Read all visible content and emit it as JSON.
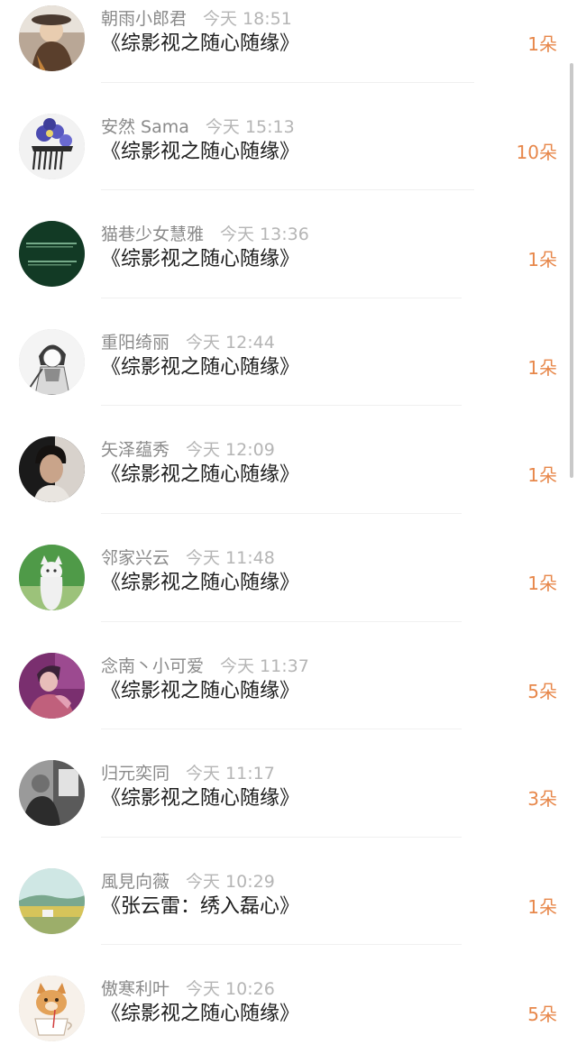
{
  "list": {
    "items": [
      {
        "name": "朝雨小郎君",
        "time": "今天 18:51",
        "title": "《综影视之随心随缘》",
        "count": "1朵",
        "avatar": "girl-with-hat-avatar"
      },
      {
        "name": "安然 Sama",
        "time": "今天 15:13",
        "title": "《综影视之随心随缘》",
        "count": "10朵",
        "avatar": "purple-flower-hairpin-avatar"
      },
      {
        "name": "猫巷少女慧雅",
        "time": "今天 13:36",
        "title": "《综影视之随心随缘》",
        "count": "1朵",
        "avatar": "green-text-avatar"
      },
      {
        "name": "重阳绮丽",
        "time": "今天 12:44",
        "title": "《综影视之随心随缘》",
        "count": "1朵",
        "avatar": "anime-sketch-avatar"
      },
      {
        "name": "矢泽蕴秀",
        "time": "今天 12:09",
        "title": "《综影视之随心随缘》",
        "count": "1朵",
        "avatar": "man-portrait-avatar"
      },
      {
        "name": "邻家兴云",
        "time": "今天 11:48",
        "title": "《综影视之随心随缘》",
        "count": "1朵",
        "avatar": "white-cat-avatar"
      },
      {
        "name": "念南丶小可爱",
        "time": "今天 11:37",
        "title": "《综影视之随心随缘》",
        "count": "5朵",
        "avatar": "purple-anime-avatar"
      },
      {
        "name": "归元奕同",
        "time": "今天 11:17",
        "title": "《综影视之随心随缘》",
        "count": "3朵",
        "avatar": "grayscale-photo-avatar"
      },
      {
        "name": "風見向薇",
        "time": "今天 10:29",
        "title": "《张云雷：绣入磊心》",
        "count": "1朵",
        "avatar": "landscape-field-avatar"
      },
      {
        "name": "傲寒利叶",
        "time": "今天 10:26",
        "title": "《综影视之随心随缘》",
        "count": "5朵",
        "avatar": "cat-with-cup-avatar"
      }
    ]
  },
  "colors": {
    "count_accent": "#e7874a",
    "name_gray": "#8a8a8a",
    "time_gray": "#b5b5b5",
    "title_dark": "#1e1e1e"
  }
}
